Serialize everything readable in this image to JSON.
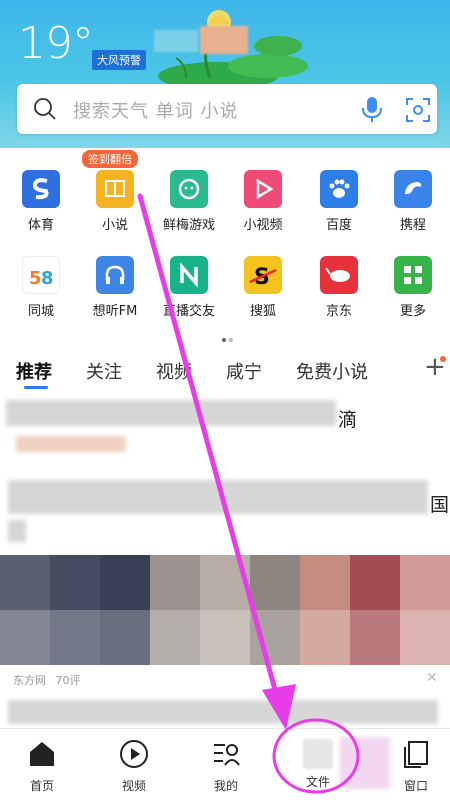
{
  "weather": {
    "temperature": "19°",
    "warning_badge": "大风预警"
  },
  "search": {
    "placeholder": "搜索天气 单词 小说"
  },
  "apps": {
    "sign_badge": "签到翻倍",
    "items": [
      {
        "label": "体育",
        "icon": "sports-icon",
        "color": "#2f6fe0"
      },
      {
        "label": "小说",
        "icon": "book-icon",
        "color": "#f6b321"
      },
      {
        "label": "鲜梅游戏",
        "icon": "game-icon",
        "color": "#2bb990"
      },
      {
        "label": "小视频",
        "icon": "video-play-icon",
        "color": "#f04a77"
      },
      {
        "label": "百度",
        "icon": "paw-icon",
        "color": "#2f7de6"
      },
      {
        "label": "携程",
        "icon": "dolphin-icon",
        "color": "#3a83e8"
      },
      {
        "label": "同城",
        "icon": "city-58-icon",
        "color": "#ffffff"
      },
      {
        "label": "想听FM",
        "icon": "headphone-icon",
        "color": "#3e86e6"
      },
      {
        "label": "直播交友",
        "icon": "live-icon",
        "color": "#19b38a"
      },
      {
        "label": "搜狐",
        "icon": "sohu-icon",
        "color": "#f5c31d"
      },
      {
        "label": "京东",
        "icon": "jd-dog-icon",
        "color": "#e8323b"
      },
      {
        "label": "更多",
        "icon": "grid-more-icon",
        "color": "#36b44a"
      }
    ]
  },
  "tabs": {
    "items": [
      "推荐",
      "关注",
      "视频",
      "咸宁",
      "免费小说"
    ]
  },
  "feed": {
    "item1_tail": "滴",
    "item2_tail": "国",
    "source": "东方网",
    "comments": "70评"
  },
  "bottom_nav": {
    "items": [
      {
        "label": "首页",
        "icon": "home-icon"
      },
      {
        "label": "视频",
        "icon": "play-circle-icon"
      },
      {
        "label": "我的",
        "icon": "profile-list-icon"
      },
      {
        "label": "文件",
        "icon": "file-icon"
      },
      {
        "label": "窗口",
        "icon": "window-icon"
      }
    ]
  },
  "colors": {
    "header_blue": "#3fb6ea",
    "accent_blue": "#2a7df4",
    "annotation_magenta": "#e83ce8",
    "badge_orange": "#f4663a"
  }
}
